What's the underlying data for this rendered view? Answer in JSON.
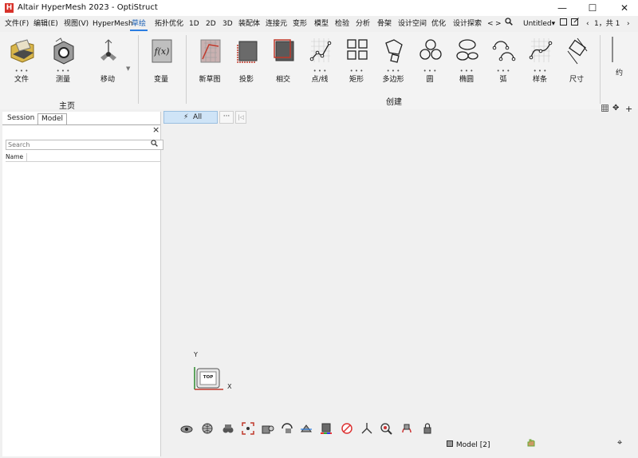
{
  "window": {
    "title": "Altair HyperMesh 2023 - OptiStruct",
    "logo_letter": "H",
    "minimize": "—",
    "maximize": "☐",
    "close": "✕"
  },
  "menubar": {
    "items": [
      "文件(F)",
      "编辑(E)",
      "视图(V)",
      "HyperMesh",
      "草绘",
      "拓扑优化",
      "1D",
      "2D",
      "3D",
      "装配体",
      "连接元",
      "变形",
      "模型",
      "检验",
      "分析",
      "骨架",
      "设计空间",
      "优化",
      "设计探索"
    ],
    "active_item": "草绘",
    "nav_prev": "<",
    "nav_next": ">",
    "document_select": "Untitled",
    "page_prev": "‹",
    "page_label": "1，共 1",
    "page_next": "›"
  },
  "ribbon": {
    "home_section_label": "主页",
    "create_section_label": "创建",
    "buttons": {
      "file": "文件",
      "measure": "测量",
      "move": "移动",
      "variable": "变量",
      "new_sketch": "新草图",
      "project": "投影",
      "intersect": "相交",
      "point_line": "点/线",
      "rectangle": "矩形",
      "polygon": "多边形",
      "circle": "圆",
      "ellipse": "椭圆",
      "arc": "弧",
      "spline": "样条",
      "dimension": "尺寸",
      "truncated": "约"
    },
    "dots": "• • •"
  },
  "left_panel": {
    "tabs": [
      "Session",
      "Model"
    ],
    "active_tab": "Model",
    "close": "×",
    "search_placeholder": "Search",
    "column_name": "Name"
  },
  "filter": {
    "all_label": "All",
    "more": "···"
  },
  "triad": {
    "y_label": "Y",
    "x_label": "X",
    "cube_label": "TOP"
  },
  "status": {
    "model_label": "Model [2]"
  },
  "colors": {
    "accent": "#2a7de1",
    "logo": "#d8322a",
    "filter_bg": "#cfe4f7"
  }
}
